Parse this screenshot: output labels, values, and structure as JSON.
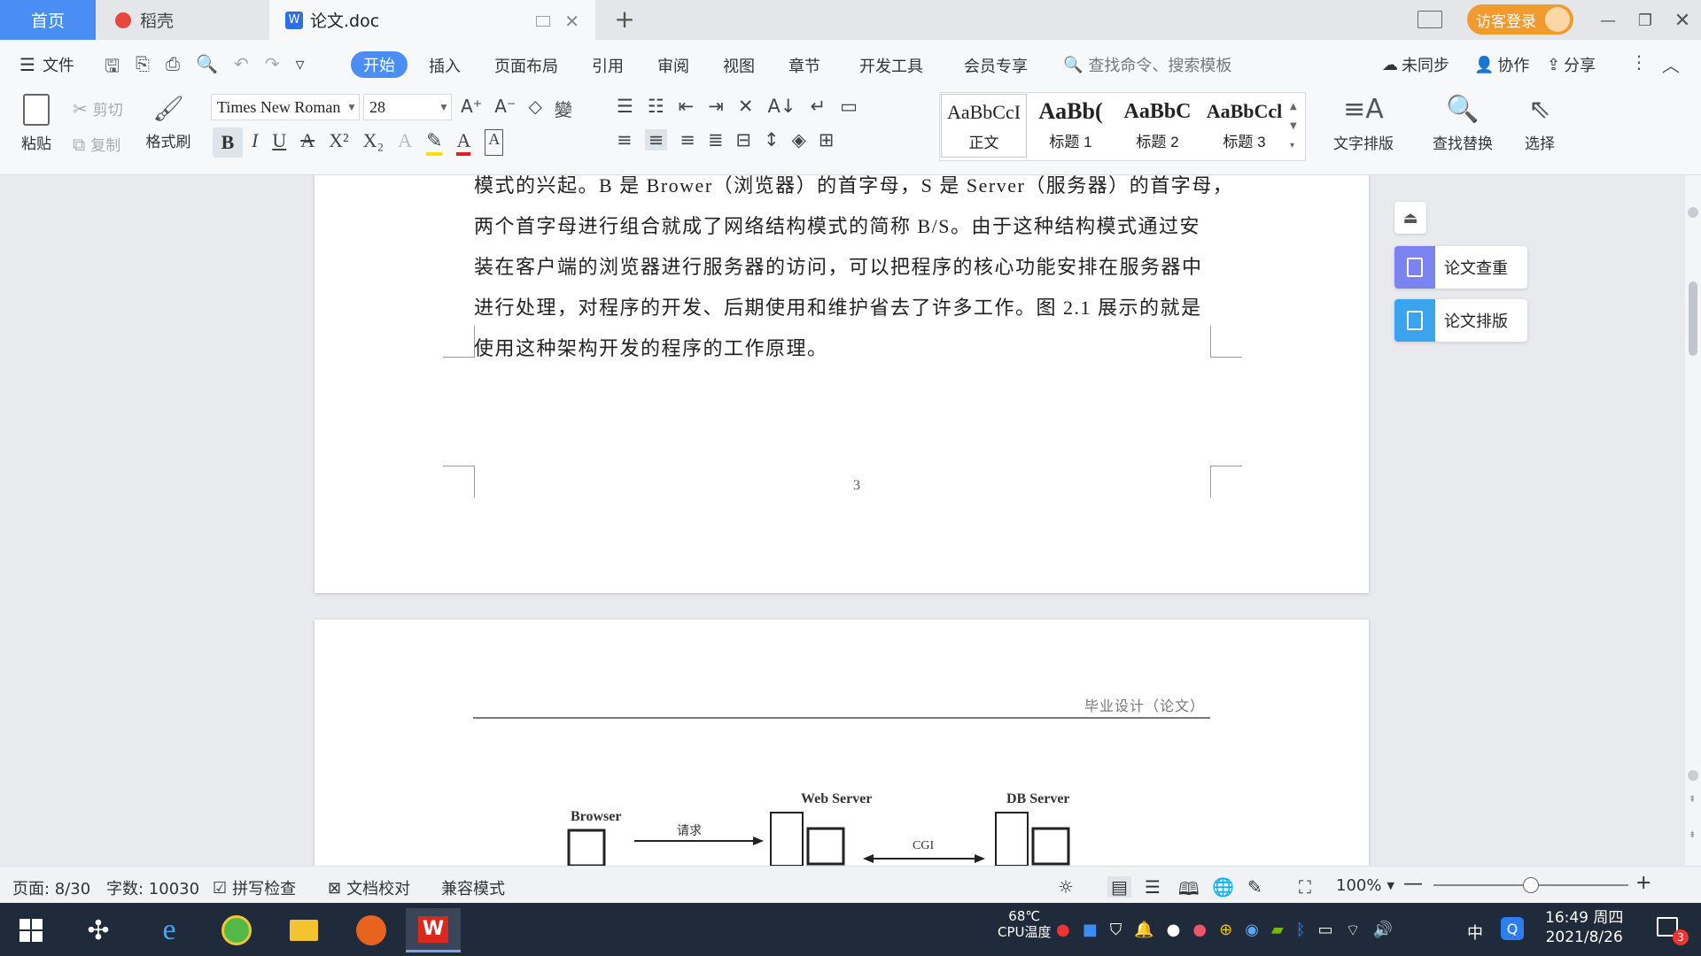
{
  "tabs": {
    "home": "首页",
    "daoke": "稻壳",
    "doc": "论文.doc",
    "new_tab": "+"
  },
  "titlebar": {
    "login": "访客登录"
  },
  "menu": {
    "file": "文件",
    "items": [
      "开始",
      "插入",
      "页面布局",
      "引用",
      "审阅",
      "视图",
      "章节",
      "开发工具",
      "会员专享"
    ],
    "search_placeholder": "查找命令、搜索模板",
    "sync": "未同步",
    "collab": "协作",
    "share": "分享"
  },
  "ribbon": {
    "paste": "粘贴",
    "cut": "剪切",
    "copy": "复制",
    "format_painter": "格式刷",
    "font_name": "Times New Roman",
    "font_size": "28",
    "styles": [
      {
        "sample": "AaBbCcI",
        "label": "正文"
      },
      {
        "sample": "AaBb(",
        "label": "标题 1"
      },
      {
        "sample": "AaBbC",
        "label": "标题 2"
      },
      {
        "sample": "AaBbCcl",
        "label": "标题 3"
      }
    ],
    "text_layout": "文字排版",
    "find_replace": "查找替换",
    "select": "选择"
  },
  "document": {
    "page1_lines": [
      "模式的兴起。B 是 Brower（浏览器）的首字母，S 是 Server（服务器）的首字母，",
      "两个首字母进行组合就成了网络结构模式的简称 B/S。由于这种结构模式通过安",
      "装在客户端的浏览器进行服务器的访问，可以把程序的核心功能安排在服务器中",
      "进行处理，对程序的开发、后期使用和维护省去了许多工作。图 2.1 展示的就是",
      "使用这种架构开发的程序的工作原理。"
    ],
    "page_number": "3",
    "page2_header": "毕业设计（论文）",
    "diagram": {
      "browser": "Browser",
      "web_server": "Web Server",
      "db_server": "DB Server",
      "request": "请求",
      "cgi": "CGI"
    }
  },
  "side_panel": {
    "check": "论文查重",
    "format": "论文排版"
  },
  "status": {
    "page": "页面: 8/30",
    "words": "字数: 10030",
    "spell": "拼写检查",
    "proof": "文档校对",
    "compat": "兼容模式",
    "zoom": "100%",
    "zoom_level": 0.5
  },
  "taskbar": {
    "temp": "68℃",
    "cpu": "CPU温度",
    "ime": "中",
    "time": "16:49 周四",
    "date": "2021/8/26",
    "notif_count": "3"
  }
}
